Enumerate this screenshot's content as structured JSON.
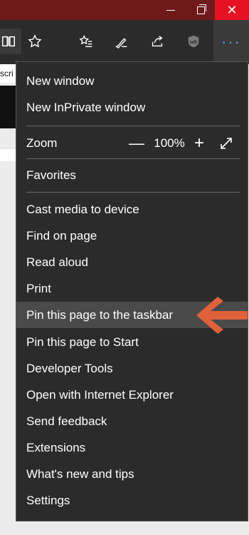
{
  "window": {
    "minimize_icon": "minimize-icon",
    "maximize_icon": "restore-icon",
    "close_glyph": "✕"
  },
  "toolbar": {
    "icons": [
      "reading-view-icon",
      "favorite-star-icon",
      "favorites-hub-icon",
      "web-note-pen-icon",
      "share-icon",
      "ublock-extension-icon"
    ],
    "more_glyph": "···",
    "page_snippet": "scri"
  },
  "menu": {
    "new_window": "New window",
    "new_inprivate": "New InPrivate window",
    "zoom_label": "Zoom",
    "zoom_minus": "—",
    "zoom_value": "100%",
    "zoom_plus": "+",
    "favorites": "Favorites",
    "cast_media": "Cast media to device",
    "find_on_page": "Find on page",
    "read_aloud": "Read aloud",
    "print": "Print",
    "pin_taskbar": "Pin this page to the taskbar",
    "pin_start": "Pin this page to Start",
    "developer_tools": "Developer Tools",
    "open_ie": "Open with Internet Explorer",
    "send_feedback": "Send feedback",
    "extensions": "Extensions",
    "whats_new": "What's new and tips",
    "settings": "Settings"
  },
  "colors": {
    "title_bar": "#6e1a1a",
    "close_button": "#e81123",
    "menu_bg": "#2b2b2b",
    "highlight": "#4a4a4a",
    "accent_dots": "#5aa0ff",
    "annotation_arrow": "#e0603a"
  }
}
